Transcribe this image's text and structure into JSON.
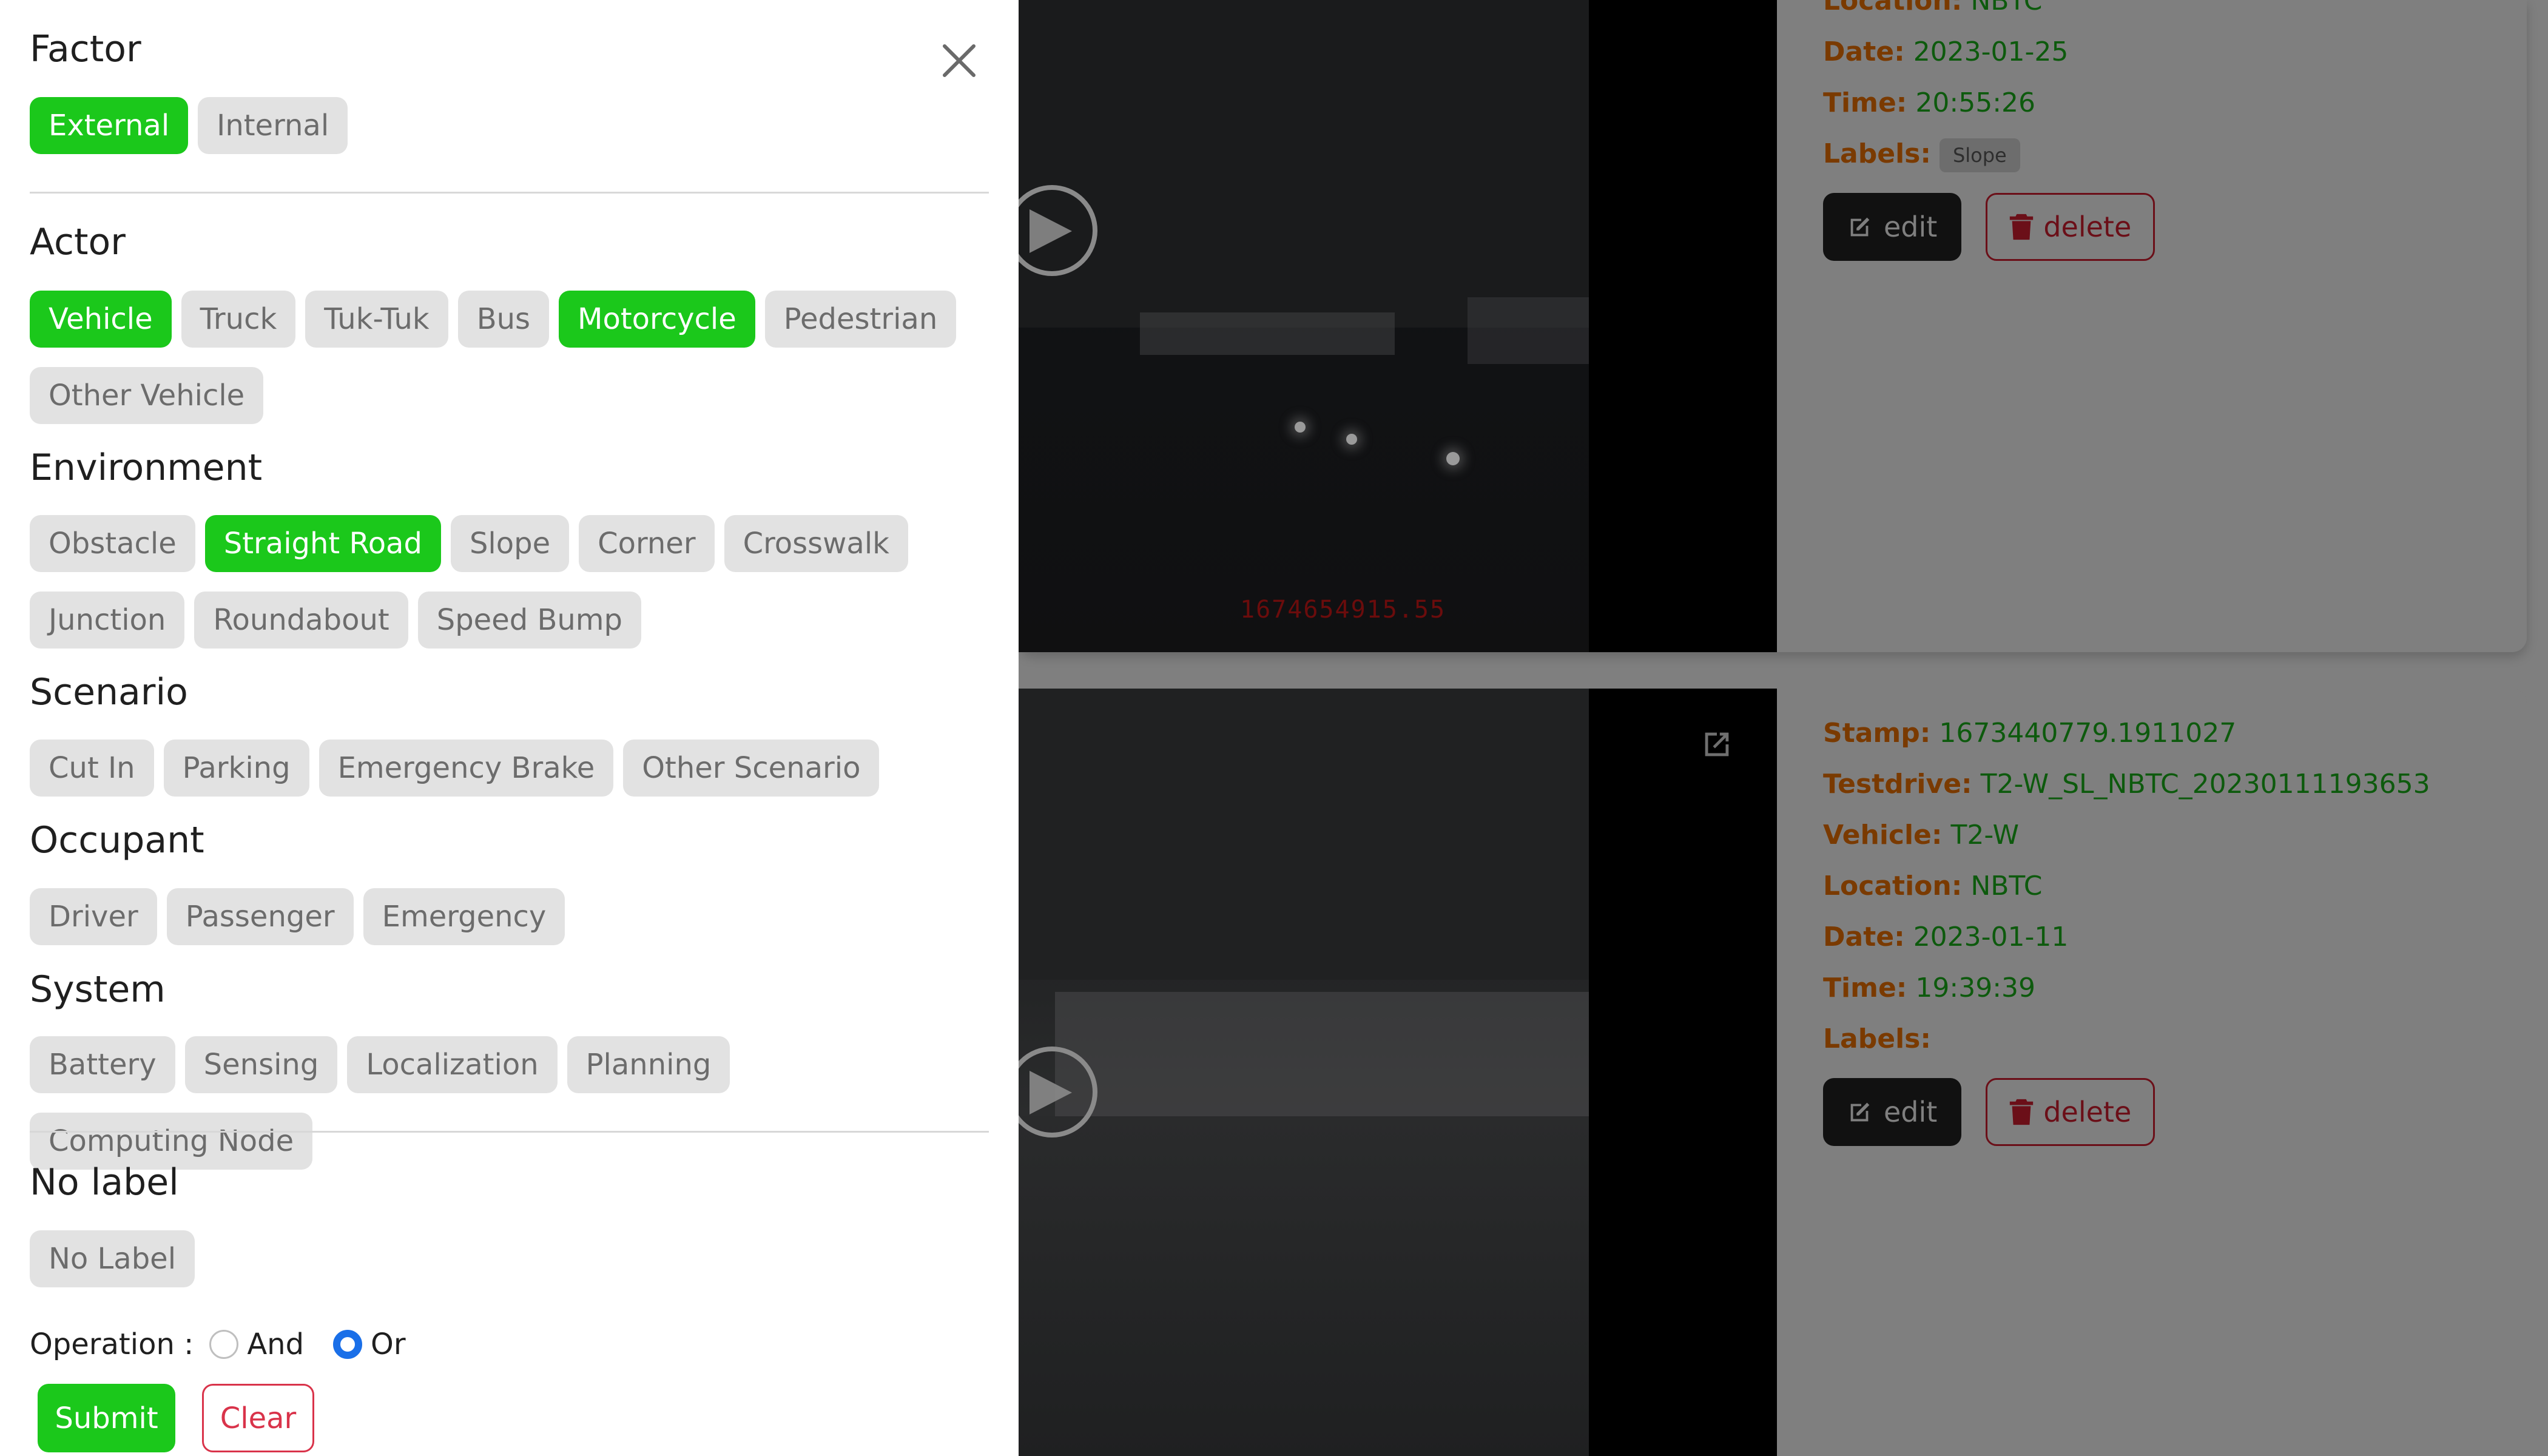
{
  "filter_panel": {
    "sections": {
      "factor": {
        "title": "Factor",
        "chips": [
          {
            "label": "External",
            "selected": true
          },
          {
            "label": "Internal",
            "selected": false
          }
        ]
      },
      "actor": {
        "title": "Actor",
        "chips": [
          {
            "label": "Vehicle",
            "selected": true
          },
          {
            "label": "Truck",
            "selected": false
          },
          {
            "label": "Tuk-Tuk",
            "selected": false
          },
          {
            "label": "Bus",
            "selected": false
          },
          {
            "label": "Motorcycle",
            "selected": true
          },
          {
            "label": "Pedestrian",
            "selected": false
          },
          {
            "label": "Other Vehicle",
            "selected": false
          }
        ]
      },
      "environment": {
        "title": "Environment",
        "chips": [
          {
            "label": "Obstacle",
            "selected": false
          },
          {
            "label": "Straight Road",
            "selected": true
          },
          {
            "label": "Slope",
            "selected": false
          },
          {
            "label": "Corner",
            "selected": false
          },
          {
            "label": "Crosswalk",
            "selected": false
          },
          {
            "label": "Junction",
            "selected": false
          },
          {
            "label": "Roundabout",
            "selected": false
          },
          {
            "label": "Speed Bump",
            "selected": false
          }
        ]
      },
      "scenario": {
        "title": "Scenario",
        "chips": [
          {
            "label": "Cut In",
            "selected": false
          },
          {
            "label": "Parking",
            "selected": false
          },
          {
            "label": "Emergency Brake",
            "selected": false
          },
          {
            "label": "Other Scenario",
            "selected": false
          }
        ]
      },
      "occupant": {
        "title": "Occupant",
        "chips": [
          {
            "label": "Driver",
            "selected": false
          },
          {
            "label": "Passenger",
            "selected": false
          },
          {
            "label": "Emergency",
            "selected": false
          }
        ]
      },
      "system": {
        "title": "System",
        "chips": [
          {
            "label": "Battery",
            "selected": false
          },
          {
            "label": "Sensing",
            "selected": false
          },
          {
            "label": "Localization",
            "selected": false
          },
          {
            "label": "Planning",
            "selected": false
          },
          {
            "label": "Computing Node",
            "selected": false
          }
        ]
      },
      "no_label": {
        "title": "No label",
        "chips": [
          {
            "label": "No Label",
            "selected": false
          }
        ]
      }
    },
    "operation": {
      "label": "Operation :",
      "options": [
        {
          "label": "And",
          "checked": false
        },
        {
          "label": "Or",
          "checked": true
        }
      ]
    },
    "submit_label": "Submit",
    "clear_label": "Clear",
    "icons": {
      "close": "close-icon"
    },
    "colors": {
      "selected_chip": "#1bc81b",
      "unselected_chip": "#e2e2e2",
      "radio_checked": "#1a6fe8",
      "clear": "#d9334a"
    }
  },
  "records": [
    {
      "video_timestamp": "1674654915.55",
      "fields": [
        {
          "label": "Location:",
          "value": "NBTC"
        },
        {
          "label": "Date:",
          "value": "2023-01-25"
        },
        {
          "label": "Time:",
          "value": "20:55:26"
        }
      ],
      "labels_label": "Labels:",
      "tags": [
        "Slope"
      ],
      "edit_label": "edit",
      "delete_label": "delete"
    },
    {
      "fields": [
        {
          "label": "Stamp:",
          "value": "1673440779.1911027"
        },
        {
          "label": "Testdrive:",
          "value": "T2-W_SL_NBTC_20230111193653"
        },
        {
          "label": "Vehicle:",
          "value": "T2-W"
        },
        {
          "label": "Location:",
          "value": "NBTC"
        },
        {
          "label": "Date:",
          "value": "2023-01-11"
        },
        {
          "label": "Time:",
          "value": "19:39:39"
        }
      ],
      "labels_label": "Labels:",
      "tags": [],
      "edit_label": "edit",
      "delete_label": "delete",
      "icons": {
        "open_external": "external-link-icon"
      }
    }
  ]
}
